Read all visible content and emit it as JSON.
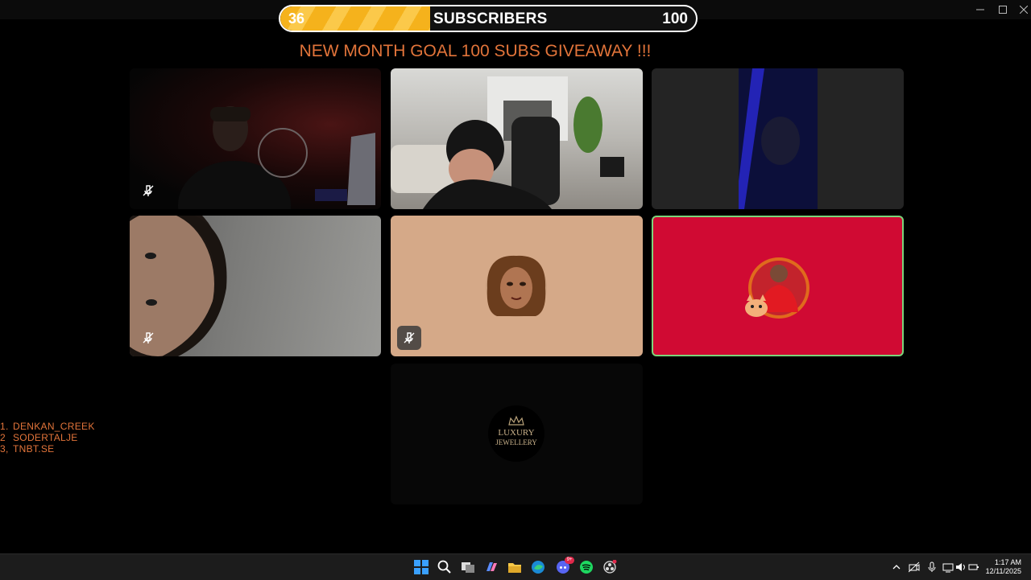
{
  "subscribers": {
    "current": "36",
    "label": "SUBSCRIBERS",
    "goal": "100",
    "progress_fraction": 0.36,
    "fill_colors": [
      "#f5b21c",
      "#fbc94a"
    ]
  },
  "banner": {
    "text": "NEW MONTH GOAL 100 SUBS GIVEAWAY !!!",
    "color": "#e2743a"
  },
  "tiles": [
    {
      "name": "participant-1",
      "kind": "camera",
      "muted": true
    },
    {
      "name": "participant-2",
      "kind": "camera",
      "muted": false
    },
    {
      "name": "participant-3",
      "kind": "camera",
      "muted": false
    },
    {
      "name": "participant-4",
      "kind": "camera",
      "muted": true
    },
    {
      "name": "participant-5",
      "kind": "avatar",
      "muted": true,
      "bg": "#d5a988"
    },
    {
      "name": "participant-6",
      "kind": "avatar",
      "muted": false,
      "bg": "#d00a33",
      "speaking": true
    },
    {
      "name": "participant-7",
      "kind": "logo",
      "muted": false,
      "logo_line1": "LUXURY",
      "logo_line2": "JEWELLERY"
    }
  ],
  "leaderboard": [
    {
      "rank": "1.",
      "name": "DENKAN_CREEK"
    },
    {
      "rank": "2",
      "name": "SODERTALJE"
    },
    {
      "rank": "3,",
      "name": "TNBT.SE"
    }
  ],
  "taskbar": {
    "icons": [
      "windows-start-icon",
      "search-icon",
      "task-view-icon",
      "copilot-icon",
      "file-explorer-icon",
      "edge-icon",
      "discord-icon",
      "spotify-icon",
      "obs-icon"
    ],
    "discord_badge": "9+",
    "tray_icons": [
      "chevron-up-icon",
      "camera-off-icon",
      "microphone-icon",
      "network-icon",
      "volume-icon",
      "battery-icon"
    ],
    "time": "1:17 AM",
    "date": "12/11/2025"
  }
}
